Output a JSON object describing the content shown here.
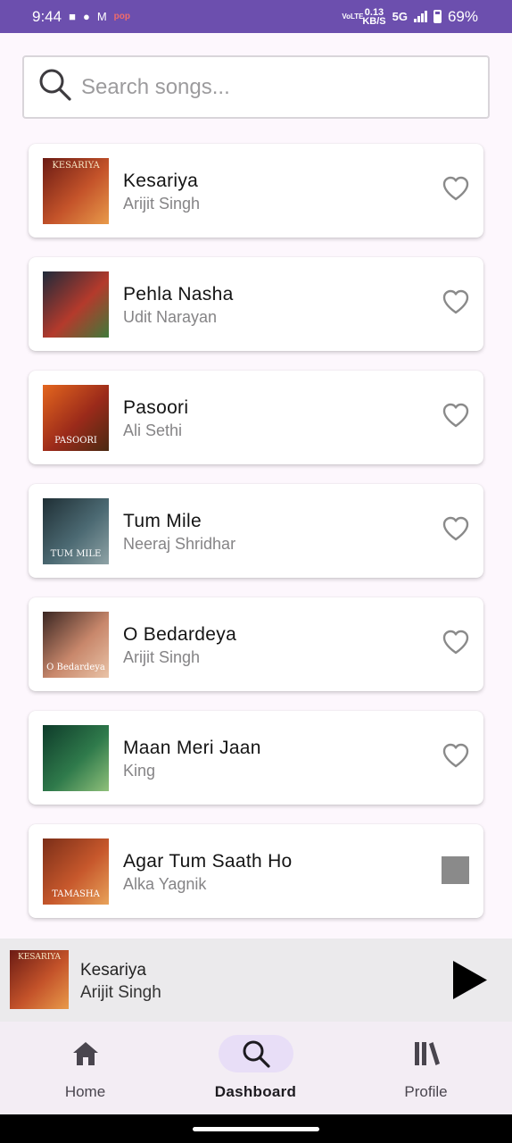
{
  "status_bar": {
    "time": "9:44",
    "pop_label": "pop",
    "volte_label": "VoLTE",
    "speed_value": "0.13",
    "speed_unit": "KB/S",
    "network": "5G",
    "battery": "69%"
  },
  "search": {
    "placeholder": "Search songs..."
  },
  "songs": [
    {
      "title": "Kesariya",
      "artist": "Arijit Singh",
      "art_label": "KESARIYA",
      "art_colors": [
        "#6b1b14",
        "#c4532a",
        "#e89a4a"
      ],
      "action": "favorite"
    },
    {
      "title": "Pehla Nasha",
      "artist": "Udit Narayan",
      "art_label": "",
      "art_colors": [
        "#1f2a3a",
        "#b43a2c",
        "#3f7a3a"
      ],
      "action": "favorite"
    },
    {
      "title": "Pasoori",
      "artist": "Ali Sethi",
      "art_label": "PASOORI",
      "art_colors": [
        "#e3661e",
        "#9b2a1a",
        "#4a2a12"
      ],
      "action": "favorite"
    },
    {
      "title": "Tum Mile",
      "artist": "Neeraj Shridhar",
      "art_label": "TUM MILE",
      "art_colors": [
        "#1f2f35",
        "#4c6a73",
        "#8fa3a6"
      ],
      "action": "favorite"
    },
    {
      "title": "O Bedardeya",
      "artist": "Arijit Singh",
      "art_label": "O Bedardeya",
      "art_colors": [
        "#3a2622",
        "#c8876b",
        "#e9c3a7"
      ],
      "action": "favorite"
    },
    {
      "title": "Maan Meri Jaan",
      "artist": "King",
      "art_label": "",
      "art_colors": [
        "#0e3b2a",
        "#2f7a4b",
        "#8fc07a"
      ],
      "action": "favorite"
    },
    {
      "title": "Agar Tum Saath Ho",
      "artist": "Alka Yagnik",
      "art_label": "TAMASHA",
      "art_colors": [
        "#7b2e18",
        "#c7582c",
        "#e8a35a"
      ],
      "action": "stop"
    }
  ],
  "now_playing": {
    "title": "Kesariya",
    "artist": "Arijit Singh",
    "art_label": "KESARIYA"
  },
  "nav": {
    "items": [
      {
        "label": "Home",
        "icon": "home-icon",
        "active": false
      },
      {
        "label": "Dashboard",
        "icon": "search-icon",
        "active": true
      },
      {
        "label": "Profile",
        "icon": "library-icon",
        "active": false
      }
    ]
  },
  "colors": {
    "status_bar": "#6c4fae",
    "background": "#fdf7fd",
    "active_nav_pill": "#e8def7",
    "heart_outline": "#8a8a8a"
  }
}
